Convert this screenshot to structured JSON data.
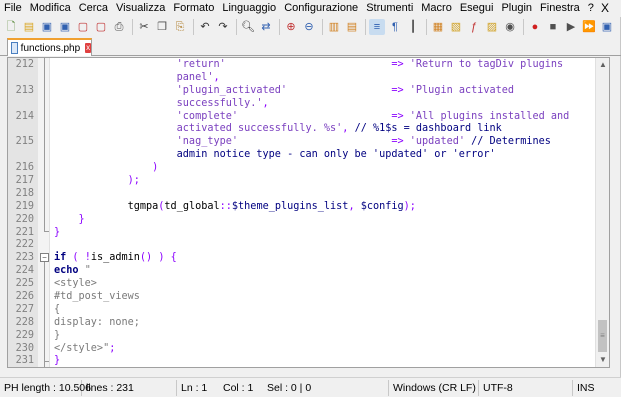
{
  "menubar": {
    "items": [
      "File",
      "Modifica",
      "Cerca",
      "Visualizza",
      "Formato",
      "Linguaggio",
      "Configurazione",
      "Strumenti",
      "Macro",
      "Esegui",
      "Plugin",
      "Finestra",
      "?"
    ],
    "close": "X"
  },
  "toolbar": {
    "icons": [
      "new-file-icon",
      "open-file-icon",
      "save-icon",
      "save-all-icon",
      "close-file-icon",
      "close-all-icon",
      "print-icon",
      "cut-icon",
      "copy-icon",
      "paste-icon",
      "undo-icon",
      "redo-icon",
      "find-icon",
      "replace-icon",
      "zoom-in-icon",
      "zoom-out-icon",
      "sync-vertical-icon",
      "sync-horizontal-icon",
      "word-wrap-icon",
      "show-all-chars-icon",
      "indent-guide-icon",
      "language-icon",
      "doc-map-icon",
      "function-list-icon",
      "folder-workspace-icon",
      "monitoring-icon",
      "record-macro-icon",
      "stop-macro-icon",
      "play-macro-icon",
      "run-macro-multiple-icon",
      "save-macro-icon"
    ]
  },
  "tabs": [
    {
      "label": "functions.php",
      "close": "x"
    }
  ],
  "editor": {
    "lines": [
      {
        "n": "212",
        "code": "                    'return'                           => 'Return to tagDiv plugins"
      },
      {
        "n": "",
        "code": "                    panel',"
      },
      {
        "n": "213",
        "code": "                    'plugin_activated'                 => 'Plugin activated"
      },
      {
        "n": "",
        "code": "                    successfully.',"
      },
      {
        "n": "214",
        "code": "                    'complete'                         => 'All plugins installed and"
      },
      {
        "n": "",
        "code": "                    activated successfully. %s', // %1$s = dashboard link"
      },
      {
        "n": "215",
        "code": "                    'nag_type'                         => 'updated' // Determines"
      },
      {
        "n": "",
        "code": "                    admin notice type - can only be 'updated' or 'error'"
      },
      {
        "n": "216",
        "code": "                )"
      },
      {
        "n": "217",
        "code": "            );"
      },
      {
        "n": "218",
        "code": ""
      },
      {
        "n": "219",
        "code": "            tgmpa(td_global::$theme_plugins_list, $config);"
      },
      {
        "n": "220",
        "code": "    }"
      },
      {
        "n": "221",
        "code": "}"
      },
      {
        "n": "222",
        "code": ""
      },
      {
        "n": "223",
        "code": "if ( !is_admin() ) {"
      },
      {
        "n": "224",
        "code": "echo \""
      },
      {
        "n": "225",
        "code": "<style>"
      },
      {
        "n": "226",
        "code": "#td_post_views"
      },
      {
        "n": "227",
        "code": "{"
      },
      {
        "n": "228",
        "code": "display: none;"
      },
      {
        "n": "229",
        "code": "}"
      },
      {
        "n": "230",
        "code": "</style>\";"
      },
      {
        "n": "231",
        "code": "}"
      }
    ]
  },
  "statusbar": {
    "length": "PH length : 10.506",
    "lines": "lines : 231",
    "ln": "Ln : 1",
    "col": "Col : 1",
    "sel": "Sel : 0 | 0",
    "eol": "Windows (CR LF)",
    "encoding": "UTF-8",
    "mode": "INS"
  }
}
